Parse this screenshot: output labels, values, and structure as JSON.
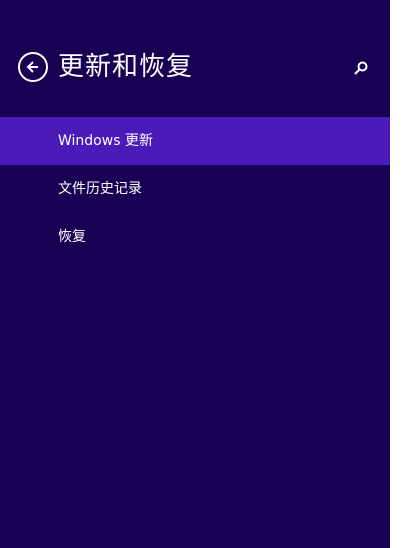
{
  "header": {
    "title": "更新和恢复",
    "back_icon": "back-arrow-circle-icon",
    "search_icon": "search-icon"
  },
  "nav": {
    "items": [
      {
        "label": "Windows 更新",
        "selected": true
      },
      {
        "label": "文件历史记录",
        "selected": false
      },
      {
        "label": "恢复",
        "selected": false
      }
    ]
  },
  "colors": {
    "pane_background": "#180052",
    "selected_background": "#4a1bb8",
    "text": "#ffffff"
  }
}
